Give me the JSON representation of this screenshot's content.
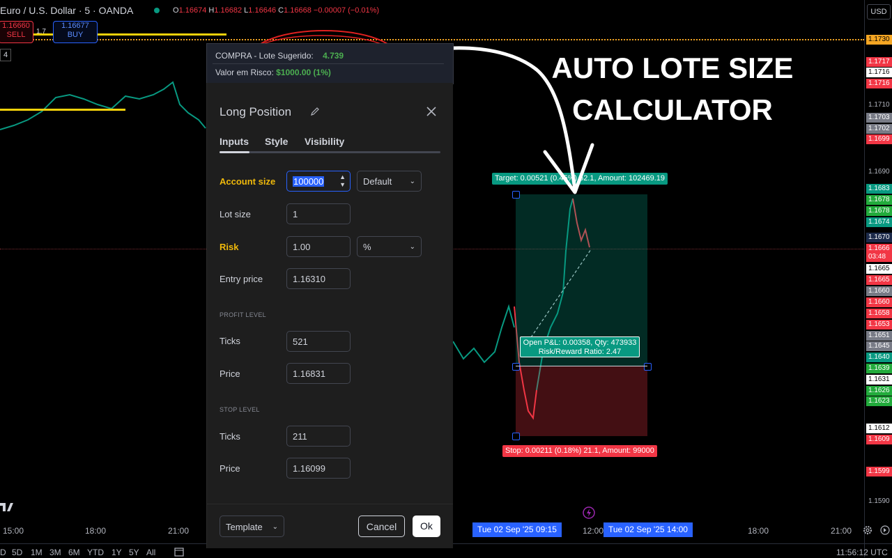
{
  "header": {
    "symbol": "Euro / U.S. Dollar · 5 · OANDA",
    "ohlc_o_label": "O",
    "ohlc_o": "1.16674",
    "ohlc_h_label": "H",
    "ohlc_h": "1.16682",
    "ohlc_l_label": "L",
    "ohlc_l": "1.16646",
    "ohlc_c_label": "C",
    "ohlc_c": "1.16668",
    "change": "−0.00007 (−0.01%)",
    "sell_price": "1.16660",
    "sell_label": "SELL",
    "buy_price": "1.16677",
    "buy_label": "BUY",
    "spread": "1.7",
    "indicator_count": "4",
    "currency": "USD"
  },
  "overlay": {
    "line1_label": "COMPRA - Lote Sugerido:",
    "line1_value": "4.739",
    "line2_label": "Valor em Risco:",
    "line2_value": "$1000.00 (1%)"
  },
  "annotation": {
    "line1": "AUTO LOTE SIZE",
    "line2": "CALCULATOR"
  },
  "position": {
    "target_label": "Target: 0.00521 (0.45%) 52.1, Amount: 102469.19",
    "stop_label": "Stop: 0.00211 (0.18%) 21.1, Amount: 99000",
    "pnl_line1": "Open P&L: 0.00358, Qty: 473933",
    "pnl_line2": "Risk/Reward Ratio: 2.47"
  },
  "dialog": {
    "title": "Long Position",
    "tabs": [
      {
        "label": "Inputs"
      },
      {
        "label": "Style"
      },
      {
        "label": "Visibility"
      }
    ],
    "account_size_label": "Account size",
    "account_size_value": "100000",
    "account_mode": "Default",
    "lot_size_label": "Lot size",
    "lot_size_value": "1",
    "risk_label": "Risk",
    "risk_value": "1.00",
    "risk_unit": "%",
    "entry_label": "Entry price",
    "entry_value": "1.16310",
    "profit_section": "PROFIT LEVEL",
    "profit_ticks_label": "Ticks",
    "profit_ticks_value": "521",
    "profit_price_label": "Price",
    "profit_price_value": "1.16831",
    "stop_section": "STOP LEVEL",
    "stop_ticks_label": "Ticks",
    "stop_ticks_value": "211",
    "stop_price_label": "Price",
    "stop_price_value": "1.16099",
    "template_label": "Template",
    "cancel_label": "Cancel",
    "ok_label": "Ok"
  },
  "price_axis": [
    {
      "text": "1.1730",
      "color": "#f5a623",
      "fg": "#000"
    },
    {
      "text": "1.1717",
      "color": "#f23645",
      "fg": "#fff"
    },
    {
      "text": "1.1716",
      "color": "#ffffff",
      "fg": "#000"
    },
    {
      "text": "1.1716",
      "color": "#f23645",
      "fg": "#fff"
    },
    {
      "text": "1.1710",
      "color": "#000000",
      "fg": "#b2b5be"
    },
    {
      "text": "1.1703",
      "color": "#787b86",
      "fg": "#fff"
    },
    {
      "text": "1.1702",
      "color": "#787b86",
      "fg": "#fff"
    },
    {
      "text": "1.1699",
      "color": "#f23645",
      "fg": "#fff"
    },
    {
      "text": "1.1690",
      "color": "#000000",
      "fg": "#b2b5be"
    },
    {
      "text": "1.1683",
      "color": "#089981",
      "fg": "#fff"
    },
    {
      "text": "1.1678",
      "color": "#22ab3c",
      "fg": "#fff"
    },
    {
      "text": "1.1678",
      "color": "#22ab3c",
      "fg": "#fff"
    },
    {
      "text": "1.1674",
      "color": "#089981",
      "fg": "#fff"
    },
    {
      "text": "1.1670",
      "color": "#1c2a4a",
      "fg": "#fff"
    },
    {
      "text": "1.1666",
      "color": "#f23645",
      "fg": "#fff"
    },
    {
      "text": "03:48",
      "color": "#f23645",
      "fg": "#fff"
    },
    {
      "text": "1.1665",
      "color": "#ffffff",
      "fg": "#000"
    },
    {
      "text": "1.1665",
      "color": "#f23645",
      "fg": "#fff"
    },
    {
      "text": "1.1660",
      "color": "#787b86",
      "fg": "#fff"
    },
    {
      "text": "1.1660",
      "color": "#f23645",
      "fg": "#fff"
    },
    {
      "text": "1.1658",
      "color": "#f23645",
      "fg": "#fff"
    },
    {
      "text": "1.1653",
      "color": "#f23645",
      "fg": "#fff"
    },
    {
      "text": "1.1651",
      "color": "#787b86",
      "fg": "#fff"
    },
    {
      "text": "1.1645",
      "color": "#787b86",
      "fg": "#fff"
    },
    {
      "text": "1.1640",
      "color": "#089981",
      "fg": "#fff"
    },
    {
      "text": "1.1639",
      "color": "#22ab3c",
      "fg": "#fff"
    },
    {
      "text": "1.1631",
      "color": "#ffffff",
      "fg": "#000"
    },
    {
      "text": "1.1626",
      "color": "#22ab3c",
      "fg": "#fff"
    },
    {
      "text": "1.1623",
      "color": "#22ab3c",
      "fg": "#fff"
    },
    {
      "text": "1.1612",
      "color": "#ffffff",
      "fg": "#000"
    },
    {
      "text": "1.1609",
      "color": "#f23645",
      "fg": "#fff"
    },
    {
      "text": "1.1599",
      "color": "#f23645",
      "fg": "#fff"
    },
    {
      "text": "1.1590",
      "color": "#000000",
      "fg": "#b2b5be"
    }
  ],
  "time_axis": {
    "t1": "15:00",
    "t2": "18:00",
    "t3": "21:00",
    "t4": "12:00",
    "t5": "18:00",
    "t6": "21:00",
    "badge1": "Tue 02 Sep '25   09:15",
    "badge2": "Tue 02 Sep '25   14:00"
  },
  "ranges": [
    "D",
    "5D",
    "1M",
    "3M",
    "6M",
    "YTD",
    "1Y",
    "5Y",
    "All"
  ],
  "clock": "11:56:12 UTC"
}
